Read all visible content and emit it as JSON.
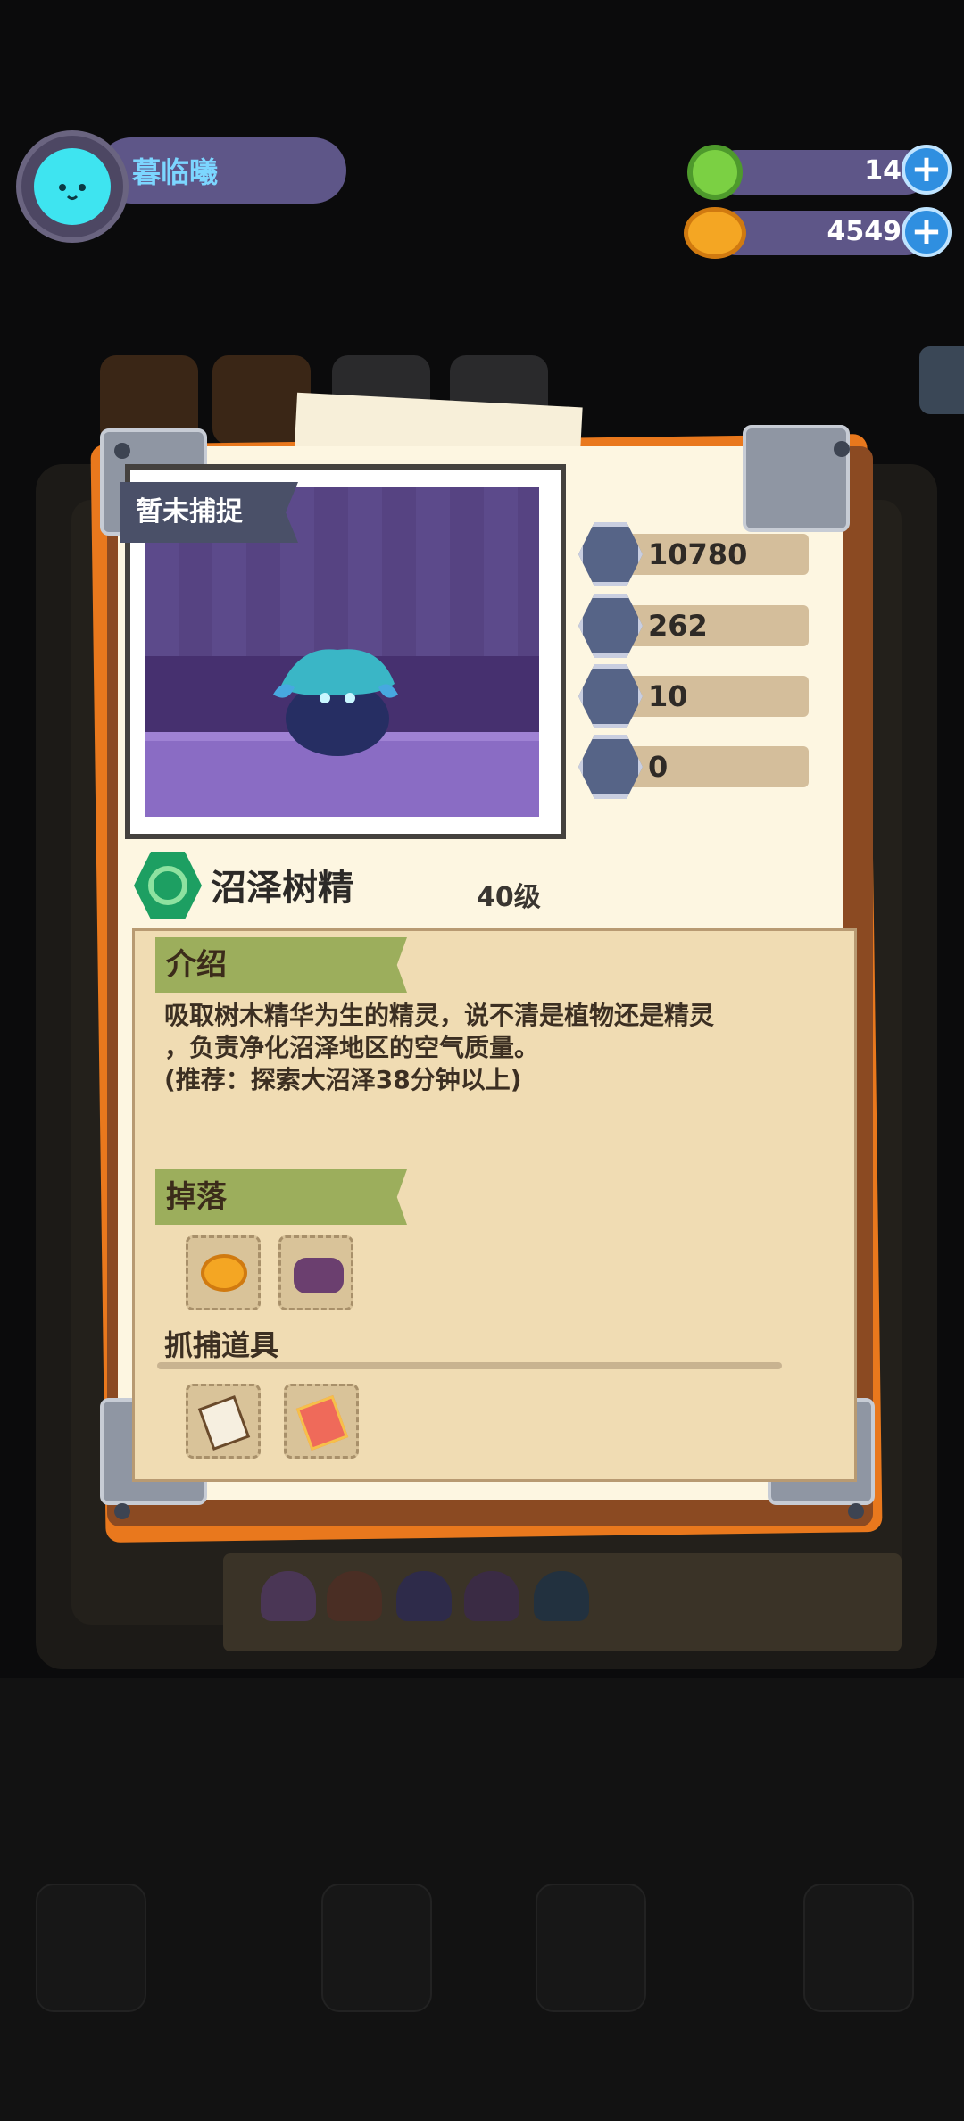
{
  "player": {
    "name": "暮临曦"
  },
  "currencies": [
    {
      "icon": "green-gem-icon",
      "value": "14"
    },
    {
      "icon": "gold-coin-icon",
      "value": "4549"
    }
  ],
  "card": {
    "status_badge": "暂未捕捉",
    "stats": [
      {
        "icon": "heart-icon",
        "value": "10780"
      },
      {
        "icon": "sword-icon",
        "value": "262"
      },
      {
        "icon": "shield-icon",
        "value": "10"
      },
      {
        "icon": "anchor-icon",
        "value": "0"
      }
    ],
    "monster_name": "沼泽树精",
    "level": "40级",
    "sections": {
      "intro_title": "介绍",
      "intro_text_1": "吸取树木精华为生的精灵，说不清是植物还是精灵",
      "intro_text_2": "，负责净化沼泽地区的空气质量。",
      "intro_text_3": "(推荐：探索大沼泽38分钟以上)",
      "drops_title": "掉落",
      "capture_title": "抓捕道具"
    }
  },
  "colors": {
    "accent_purple": "#5e5688",
    "plus_blue": "#2f8fe0",
    "card_orange": "#e9781d"
  }
}
